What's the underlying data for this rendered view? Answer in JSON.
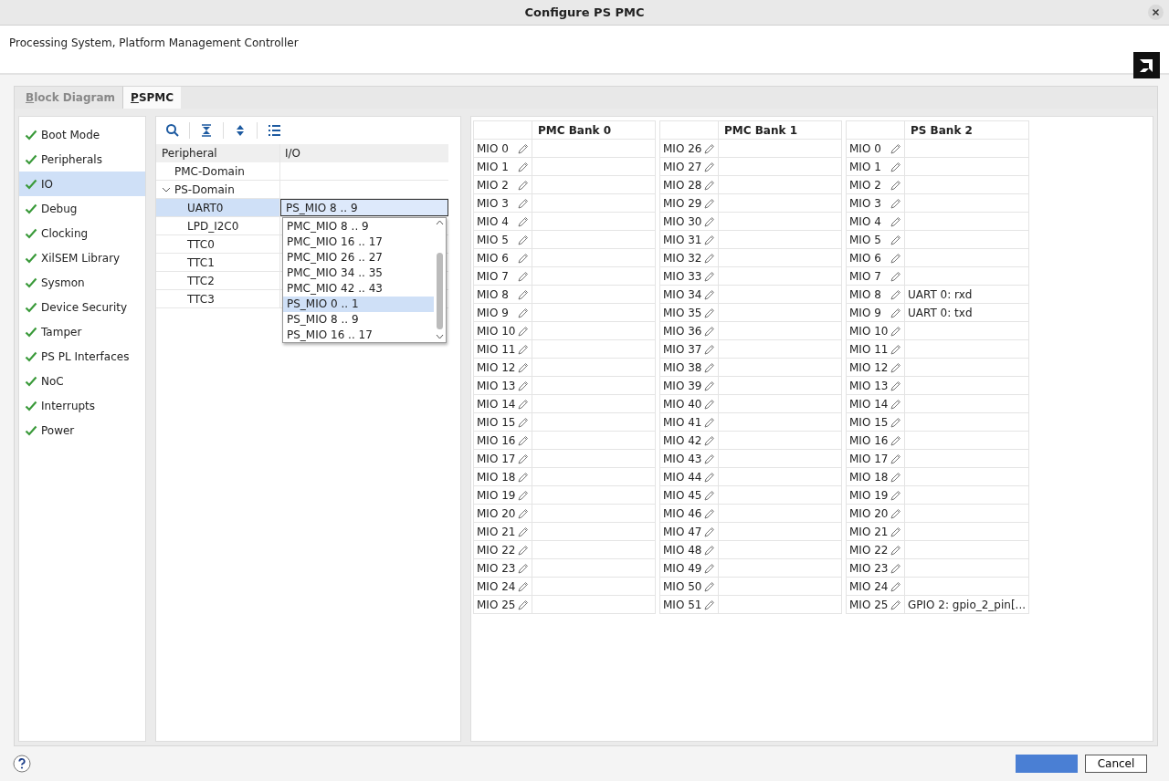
{
  "window": {
    "title": "Configure PS PMC",
    "subtitle": "Processing System, Platform Management Controller"
  },
  "tabs": [
    {
      "label": "Block Diagram",
      "first_letter_underlined": true,
      "selected": false
    },
    {
      "label": "PSPMC",
      "first_letter_underlined": true,
      "selected": true
    }
  ],
  "sidebar": {
    "items": [
      {
        "label": "Boot Mode",
        "checked": true,
        "selected": false
      },
      {
        "label": "Peripherals",
        "checked": true,
        "selected": false
      },
      {
        "label": "IO",
        "checked": true,
        "selected": true
      },
      {
        "label": "Debug",
        "checked": true,
        "selected": false
      },
      {
        "label": "Clocking",
        "checked": true,
        "selected": false
      },
      {
        "label": "XilSEM Library",
        "checked": true,
        "selected": false
      },
      {
        "label": "Sysmon",
        "checked": true,
        "selected": false
      },
      {
        "label": "Device Security",
        "checked": true,
        "selected": false
      },
      {
        "label": "Tamper",
        "checked": true,
        "selected": false
      },
      {
        "label": "PS PL Interfaces",
        "checked": true,
        "selected": false
      },
      {
        "label": "NoC",
        "checked": true,
        "selected": false
      },
      {
        "label": "Interrupts",
        "checked": true,
        "selected": false
      },
      {
        "label": "Power",
        "checked": true,
        "selected": false
      }
    ]
  },
  "tree": {
    "columns": [
      "Peripheral",
      "I/O"
    ],
    "rows": [
      {
        "label": "PMC-Domain",
        "selected": false
      },
      {
        "label": "PS-Domain",
        "selected": false,
        "expanded": true,
        "children": [
          {
            "label": "UART0",
            "selected": true,
            "io": "PS_MIO 8 .. 9"
          },
          {
            "label": "LPD_I2C0",
            "selected": false
          },
          {
            "label": "TTC0",
            "selected": false
          },
          {
            "label": "TTC1",
            "selected": false
          },
          {
            "label": "TTC2",
            "selected": false
          },
          {
            "label": "TTC3",
            "selected": false
          }
        ]
      }
    ],
    "dropdown": {
      "options": [
        {
          "label": "PMC_MIO 8 .. 9",
          "selected": false
        },
        {
          "label": "PMC_MIO 16 .. 17",
          "selected": false
        },
        {
          "label": "PMC_MIO 26 .. 27",
          "selected": false
        },
        {
          "label": "PMC_MIO 34 .. 35",
          "selected": false
        },
        {
          "label": "PMC_MIO 42 .. 43",
          "selected": false
        },
        {
          "label": "PS_MIO 0 .. 1",
          "selected": true
        },
        {
          "label": "PS_MIO 8 .. 9",
          "selected": false
        },
        {
          "label": "PS_MIO 16 .. 17",
          "selected": false
        }
      ]
    }
  },
  "banks": [
    {
      "title": "PMC Bank 0",
      "pins": [
        {
          "label": "MIO 0"
        },
        {
          "label": "MIO 1"
        },
        {
          "label": "MIO 2"
        },
        {
          "label": "MIO 3"
        },
        {
          "label": "MIO 4"
        },
        {
          "label": "MIO 5"
        },
        {
          "label": "MIO 6"
        },
        {
          "label": "MIO 7"
        },
        {
          "label": "MIO 8"
        },
        {
          "label": "MIO 9"
        },
        {
          "label": "MIO 10"
        },
        {
          "label": "MIO 11"
        },
        {
          "label": "MIO 12"
        },
        {
          "label": "MIO 13"
        },
        {
          "label": "MIO 14"
        },
        {
          "label": "MIO 15"
        },
        {
          "label": "MIO 16"
        },
        {
          "label": "MIO 17"
        },
        {
          "label": "MIO 18"
        },
        {
          "label": "MIO 19"
        },
        {
          "label": "MIO 20"
        },
        {
          "label": "MIO 21"
        },
        {
          "label": "MIO 22"
        },
        {
          "label": "MIO 23"
        },
        {
          "label": "MIO 24"
        },
        {
          "label": "MIO 25"
        }
      ]
    },
    {
      "title": "PMC Bank 1",
      "pins": [
        {
          "label": "MIO 26"
        },
        {
          "label": "MIO 27"
        },
        {
          "label": "MIO 28"
        },
        {
          "label": "MIO 29"
        },
        {
          "label": "MIO 30"
        },
        {
          "label": "MIO 31"
        },
        {
          "label": "MIO 32"
        },
        {
          "label": "MIO 33"
        },
        {
          "label": "MIO 34"
        },
        {
          "label": "MIO 35"
        },
        {
          "label": "MIO 36"
        },
        {
          "label": "MIO 37"
        },
        {
          "label": "MIO 38"
        },
        {
          "label": "MIO 39"
        },
        {
          "label": "MIO 40"
        },
        {
          "label": "MIO 41"
        },
        {
          "label": "MIO 42"
        },
        {
          "label": "MIO 43"
        },
        {
          "label": "MIO 44"
        },
        {
          "label": "MIO 45"
        },
        {
          "label": "MIO 46"
        },
        {
          "label": "MIO 47"
        },
        {
          "label": "MIO 48"
        },
        {
          "label": "MIO 49"
        },
        {
          "label": "MIO 50"
        },
        {
          "label": "MIO 51"
        }
      ]
    },
    {
      "title": "PS Bank 2",
      "pins": [
        {
          "label": "MIO 0"
        },
        {
          "label": "MIO 1"
        },
        {
          "label": "MIO 2"
        },
        {
          "label": "MIO 3"
        },
        {
          "label": "MIO 4"
        },
        {
          "label": "MIO 5"
        },
        {
          "label": "MIO 6"
        },
        {
          "label": "MIO 7"
        },
        {
          "label": "MIO 8",
          "value": "UART 0: rxd"
        },
        {
          "label": "MIO 9",
          "value": "UART 0: txd"
        },
        {
          "label": "MIO 10"
        },
        {
          "label": "MIO 11"
        },
        {
          "label": "MIO 12"
        },
        {
          "label": "MIO 13"
        },
        {
          "label": "MIO 14"
        },
        {
          "label": "MIO 15"
        },
        {
          "label": "MIO 16"
        },
        {
          "label": "MIO 17"
        },
        {
          "label": "MIO 18"
        },
        {
          "label": "MIO 19"
        },
        {
          "label": "MIO 20"
        },
        {
          "label": "MIO 21"
        },
        {
          "label": "MIO 22"
        },
        {
          "label": "MIO 23"
        },
        {
          "label": "MIO 24"
        },
        {
          "label": "MIO 25",
          "value": "GPIO 2: gpio_2_pin[..."
        }
      ]
    }
  ],
  "footer": {
    "buttons": [
      {
        "kind": "primary"
      },
      {
        "kind": "secondary",
        "label": "Cancel"
      }
    ]
  }
}
